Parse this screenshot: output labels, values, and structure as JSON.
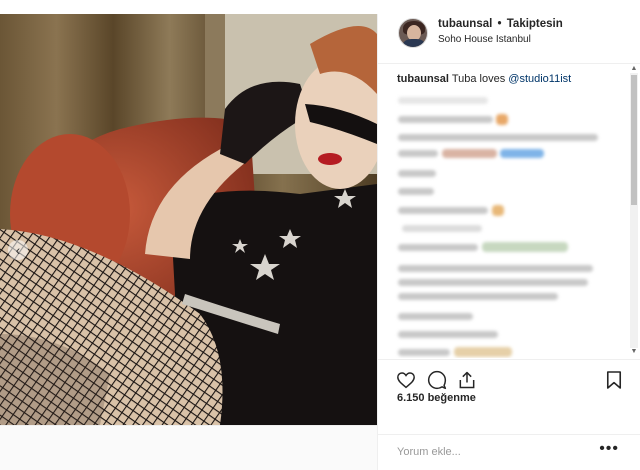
{
  "post": {
    "header": {
      "username": "tubaunsal",
      "separator": "•",
      "follow_label": "Takiptesin",
      "location": "Soho House Istanbul",
      "avatar_icon": "user-avatar-icon"
    },
    "caption": {
      "username": "tubaunsal",
      "text": "Tuba loves",
      "mention": "@studio11ist"
    },
    "carousel": {
      "prev_icon": "chevron-left-icon",
      "prev_glyph": "‹"
    },
    "actions": {
      "like_icon": "heart-icon",
      "comment_icon": "comment-bubble-icon",
      "share_icon": "share-arrow-icon",
      "save_icon": "bookmark-icon"
    },
    "likes_text": "6.150 beğenme",
    "comment_input": {
      "placeholder": "Yorum ekle...",
      "more_glyph": "•••"
    },
    "scrollbar": {
      "up_glyph": "▲",
      "down_glyph": "▼"
    },
    "colors": {
      "mention": "#003569",
      "border": "#efefef",
      "text": "#262626",
      "muted": "#999999"
    }
  }
}
